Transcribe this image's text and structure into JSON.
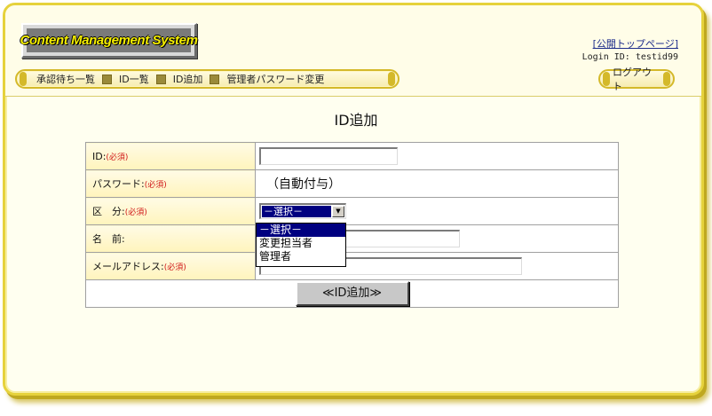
{
  "header": {
    "logo_text": "Content Management System",
    "public_top_link": "[公開トップページ]",
    "login_label": "Login ID: testid99"
  },
  "nav": {
    "items": [
      "承認待ち一覧",
      "ID一覧",
      "ID追加",
      "管理者パスワード変更"
    ],
    "logout": "ログアウト"
  },
  "page": {
    "title": "ID追加"
  },
  "form": {
    "required_mark": "(必須)",
    "fields": {
      "id": {
        "label": "ID:",
        "value": ""
      },
      "password": {
        "label": "パスワード:",
        "value": "（自動付与）"
      },
      "category": {
        "label": "区　分:",
        "selected": "－選択－"
      },
      "name": {
        "label": "名　前:",
        "value": ""
      },
      "email": {
        "label": "メールアドレス:",
        "value": ""
      }
    },
    "category_options": [
      "－選択－",
      "変更担当者",
      "管理者"
    ],
    "submit_label": "≪ID追加≫"
  },
  "colors": {
    "frame": "#e6d23c",
    "label_bg": "#fff4bc",
    "required": "#d01818",
    "selection": "#000080"
  }
}
